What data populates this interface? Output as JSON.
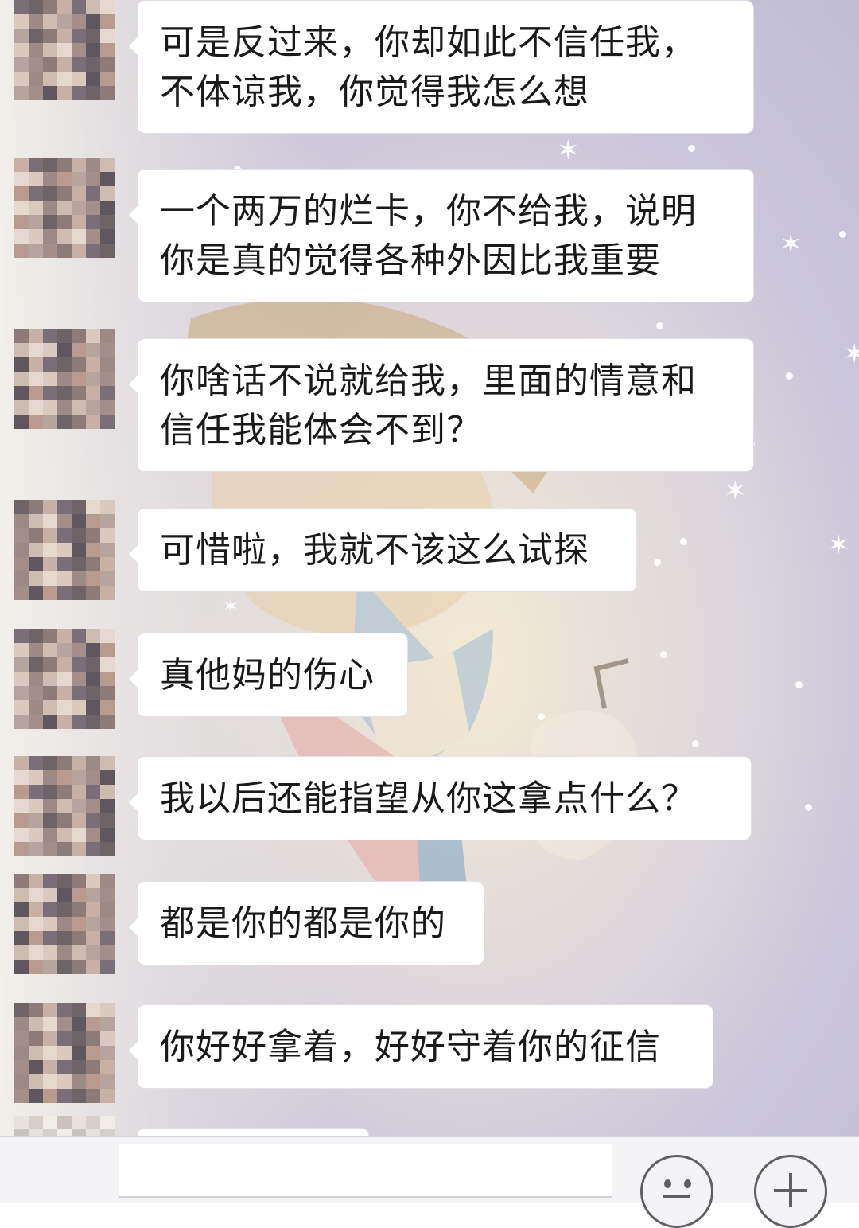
{
  "chat": {
    "messages": [
      {
        "lines": [
          "可是反过来，你却如此不信任我，",
          "不体谅我，你觉得我怎么想"
        ]
      },
      {
        "lines": [
          "一个两万的烂卡，你不给我，说明",
          "你是真的觉得各种外因比我重要"
        ]
      },
      {
        "lines": [
          "你啥话不说就给我，里面的情意和",
          "信任我能体会不到？"
        ]
      },
      {
        "lines": [
          "可惜啦，我就不该这么试探"
        ]
      },
      {
        "lines": [
          "真他妈的伤心"
        ]
      },
      {
        "lines": [
          "我以后还能指望从你这拿点什么？"
        ]
      },
      {
        "lines": [
          "都是你的都是你的"
        ]
      },
      {
        "lines": [
          "你好好拿着，好好守着你的征信"
        ]
      }
    ]
  },
  "input_bar": {
    "emoji_icon": "emoji-face-icon",
    "more_icon": "plus-icon"
  },
  "colors": {
    "bubble_bg": "#ffffff",
    "text": "#1a1a1a",
    "icon_stroke": "#5f5f66"
  }
}
